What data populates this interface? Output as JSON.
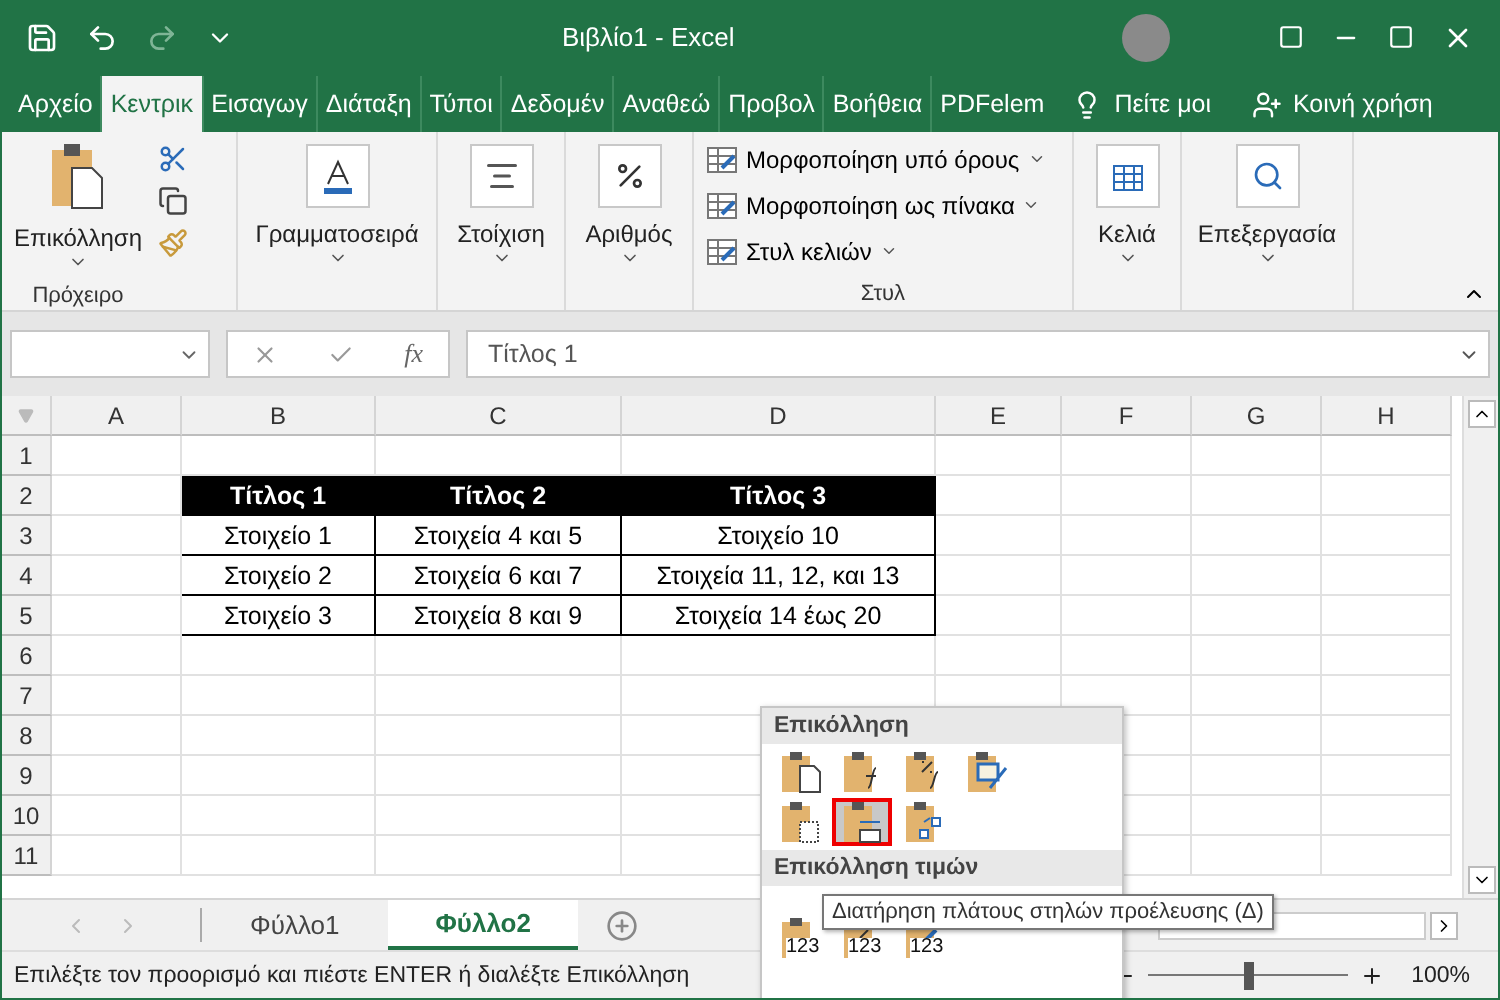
{
  "window": {
    "title": "Βιβλίο1  -  Excel"
  },
  "ribbon_tabs": [
    {
      "label": "Αρχείο",
      "selected": false
    },
    {
      "label": "Κεντρικ",
      "selected": true
    },
    {
      "label": "Εισαγωγ",
      "selected": false
    },
    {
      "label": "Διάταξη",
      "selected": false
    },
    {
      "label": "Τύποι",
      "selected": false
    },
    {
      "label": "Δεδομέν",
      "selected": false
    },
    {
      "label": "Αναθεώ",
      "selected": false
    },
    {
      "label": "Προβολ",
      "selected": false
    },
    {
      "label": "Βοήθεια",
      "selected": false
    },
    {
      "label": "PDFelem",
      "selected": false
    }
  ],
  "tell_me": "Πείτε μοι",
  "share": "Κοινή χρήση",
  "ribbon": {
    "paste": "Επικόλληση",
    "clipboard_group": "Πρόχειρο",
    "big_buttons": [
      {
        "kind": "font",
        "label": "Γραμματοσειρά"
      },
      {
        "kind": "align",
        "label": "Στοίχιση"
      },
      {
        "kind": "number",
        "label": "Αριθμός"
      }
    ],
    "style_items": [
      "Μορφοποίηση υπό όρους",
      "Μορφοποίηση ως πίνακα",
      "Στυλ κελιών"
    ],
    "style_group": "Στυλ",
    "right_buttons": [
      {
        "kind": "cells",
        "label": "Κελιά"
      },
      {
        "kind": "edit",
        "label": "Επεξεργασία"
      }
    ]
  },
  "formula_bar": {
    "function_label": "fx",
    "value": "Τίτλος 1"
  },
  "columns": [
    "A",
    "B",
    "C",
    "D",
    "E",
    "F",
    "G",
    "H"
  ],
  "row_numbers": [
    "1",
    "2",
    "3",
    "4",
    "5",
    "6",
    "7",
    "8",
    "9",
    "10",
    "11"
  ],
  "table": {
    "columns": [
      "Τίτλος 1",
      "Τίτλος 2",
      "Τίτλος 3"
    ],
    "rows": [
      [
        "Στοιχείο 1",
        "Στοιχεία 4 και 5",
        "Στοιχείο 10"
      ],
      [
        "Στοιχείο 2",
        "Στοιχεία 6 και 7",
        "Στοιχεία 11, 12, και 13"
      ],
      [
        "Στοιχείο 3",
        "Στοιχεία 8 και 9",
        "Στοιχεία 14 έως 20"
      ]
    ]
  },
  "sheet_tabs": [
    {
      "label": "Φύλλο1",
      "selected": false
    },
    {
      "label": "Φύλλο2",
      "selected": true
    }
  ],
  "paste_menu": {
    "title": "Επικόλληση",
    "options": [
      {
        "kind": "paste",
        "selected": false
      },
      {
        "kind": "formulas",
        "selected": false
      },
      {
        "kind": "formulas_number",
        "selected": false
      },
      {
        "kind": "formatting",
        "selected": false
      },
      {
        "kind": "no_borders",
        "selected": false
      },
      {
        "kind": "column_widths",
        "selected": true
      },
      {
        "kind": "transpose",
        "selected": false
      }
    ],
    "values_title": "Επικόλληση τιμών",
    "value_options": [
      {
        "kind": "values",
        "label": "123"
      },
      {
        "kind": "values_number",
        "label": "123"
      },
      {
        "kind": "values_format",
        "label": "123"
      }
    ]
  },
  "tooltip": "Διατήρηση πλάτους στηλών προέλευσης (Δ)",
  "status_bar": {
    "message": "Επιλέξτε τον προορισμό και πιέστε ENTER ή διαλέξτε Επικόλληση",
    "zoom": {
      "level": 0.5
    },
    "zoom_label": "100%"
  }
}
